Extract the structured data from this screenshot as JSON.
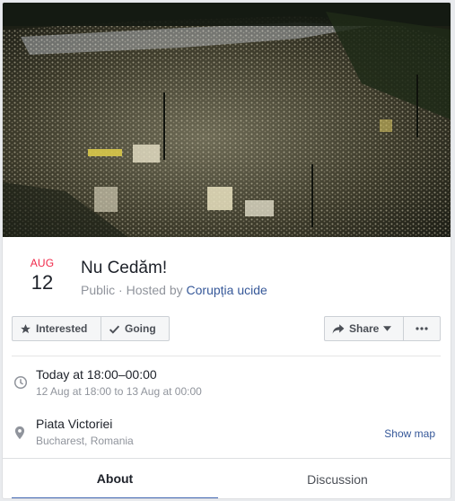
{
  "cover": {
    "image": "protest-crowd-photo"
  },
  "event": {
    "month": "AUG",
    "day": "12",
    "title": "Nu Cedăm!",
    "privacy": "Public",
    "hosted_by_prefix": "Hosted by",
    "host": "Corupția ucide"
  },
  "actions": {
    "interested_label": "Interested",
    "going_label": "Going",
    "share_label": "Share"
  },
  "details": {
    "time_main": "Today at 18:00–00:00",
    "time_sub": "12 Aug at 18:00 to 13 Aug at 00:00",
    "place_main": "Piata Victoriei",
    "place_sub": "Bucharest, Romania",
    "show_map": "Show map"
  },
  "tabs": [
    {
      "label": "About"
    },
    {
      "label": "Discussion"
    }
  ],
  "icons": {
    "interested": "star-icon",
    "going": "check-icon",
    "share": "share-arrow-icon",
    "more": "ellipsis-icon",
    "time": "clock-icon",
    "place": "location-pin-icon"
  },
  "colors": {
    "accent": "#4267b2",
    "link": "#365899",
    "month": "#f02849"
  }
}
